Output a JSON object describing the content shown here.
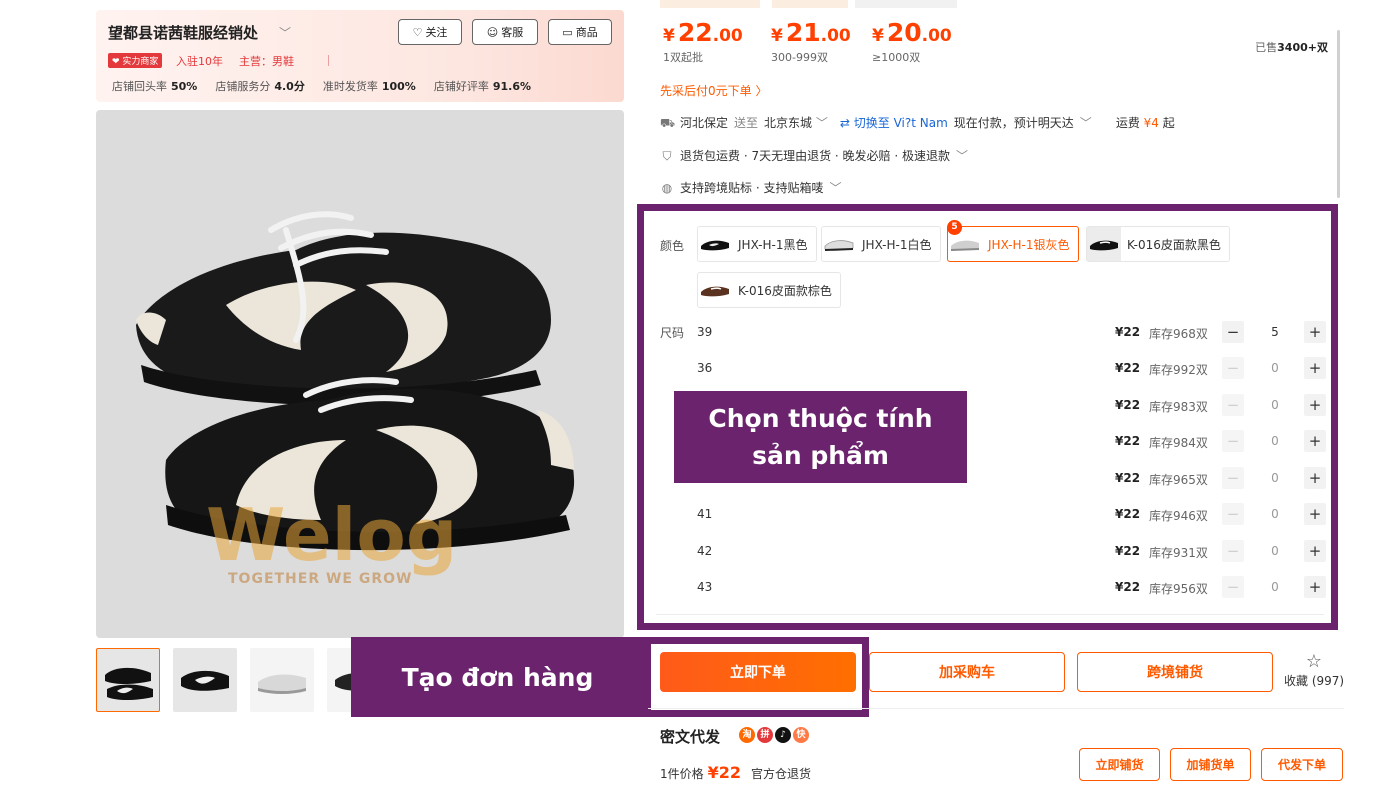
{
  "shop": {
    "name": "望都县诺茜鞋服经销处",
    "follow_label": "关注",
    "service_label": "客服",
    "goods_label": "商品",
    "strength_badge": "实力商家",
    "years": "入驻10年",
    "main_business": "主营：男鞋",
    "stats": [
      {
        "label": "店铺回头率",
        "value": "50%"
      },
      {
        "label": "店铺服务分",
        "value": "4.0分"
      },
      {
        "label": "准时发货率",
        "value": "100%"
      },
      {
        "label": "店铺好评率",
        "value": "91.6%"
      }
    ]
  },
  "price_tiers": [
    {
      "currency": "¥",
      "int": "22",
      "dec": ".00",
      "qty": "1双起批"
    },
    {
      "currency": "¥",
      "int": "21",
      "dec": ".00",
      "qty": "300-999双"
    },
    {
      "currency": "¥",
      "int": "20",
      "dec": ".00",
      "qty": "≥1000双"
    }
  ],
  "sold": {
    "prefix": "已售",
    "value": "3400+双"
  },
  "pay_later": "先采后付0元下单 〉",
  "shipping": {
    "from": "河北保定",
    "to_word": "送至",
    "to": "北京东城",
    "switch_label": "切换至 Vi?t Nam",
    "eta": "现在付款，预计明天达",
    "fee_label": "运费",
    "fee_value": "¥4",
    "fee_suffix": "起"
  },
  "guarantees": "退货包运费 · 7天无理由退货 · 晚发必赔 · 极速退款",
  "cross_border": "支持跨境贴标 · 支持贴箱唛",
  "options": {
    "color_label": "颜色",
    "size_label": "尺码",
    "colors": [
      {
        "label": "JHX-H-1黑色",
        "selected": false
      },
      {
        "label": "JHX-H-1白色",
        "selected": false
      },
      {
        "label": "JHX-H-1银灰色",
        "selected": true,
        "badge": "5"
      },
      {
        "label": "K-016皮面款黑色",
        "selected": false
      },
      {
        "label": "K-016皮面款棕色",
        "selected": false
      }
    ],
    "sizes": [
      {
        "size": "39",
        "price": "¥22",
        "stock": "库存968双",
        "qty": "5"
      },
      {
        "size": "36",
        "price": "¥22",
        "stock": "库存992双",
        "qty": "0"
      },
      {
        "size": "",
        "price": "¥22",
        "stock": "库存983双",
        "qty": "0"
      },
      {
        "size": "",
        "price": "¥22",
        "stock": "库存984双",
        "qty": "0"
      },
      {
        "size": "",
        "price": "¥22",
        "stock": "库存965双",
        "qty": "0"
      },
      {
        "size": "41",
        "price": "¥22",
        "stock": "库存946双",
        "qty": "0"
      },
      {
        "size": "42",
        "price": "¥22",
        "stock": "库存931双",
        "qty": "0"
      },
      {
        "size": "43",
        "price": "¥22",
        "stock": "库存956双",
        "qty": "0"
      }
    ],
    "minus": "−",
    "plus": "+"
  },
  "overlays": {
    "attr_line1": "Chọn thuộc tính",
    "attr_line2": "sản phẩm",
    "order": "Tạo đơn hàng"
  },
  "actions": {
    "buy_now": "立即下单",
    "add_cart": "加采购车",
    "cross_border": "跨境铺货",
    "favorite": "收藏 (997)"
  },
  "dropship": {
    "title": "密文代发",
    "one_price_label": "1件价格",
    "one_price_value": "¥22",
    "warehouse_return": "官方仓退货",
    "btn_list_now": "立即铺货",
    "btn_add_order": "加铺货单",
    "btn_proxy_order": "代发下单"
  },
  "watermark": {
    "brand": "Welog",
    "tagline": "TOGETHER WE GROW"
  },
  "colors": {
    "accent": "#ff5a00",
    "price": "#ff4000",
    "overlay": "#6b236e",
    "link": "#1a66d6"
  }
}
